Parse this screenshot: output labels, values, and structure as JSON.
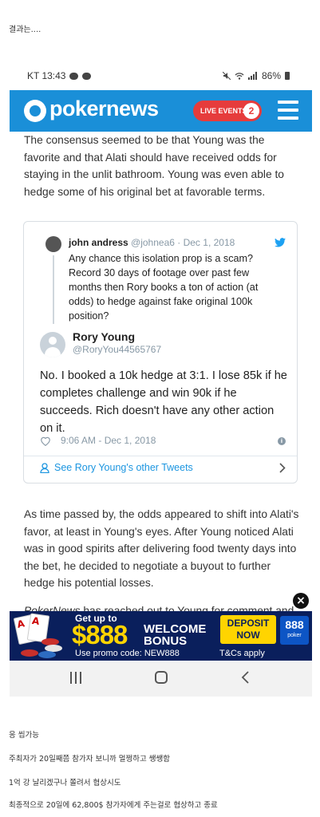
{
  "post": {
    "top_text": "결과는....",
    "comments": [
      "응 씹가능",
      "주최자가 20일째쯤 참가자 보니까 멀쩡하고 쌩쌩함",
      "1억 강 날리겠구나 쫄려서 협상시도",
      "최종적으로 20일에 62,800$ 참가자에게 주는걸로 협상하고 종료"
    ]
  },
  "status_bar": {
    "carrier_time": "KT 13:43",
    "battery": "86%"
  },
  "site_header": {
    "logo_text": "pokernews",
    "live_events_label": "LIVE EVENTS",
    "live_events_count": "2",
    "menu_icon": "hamburger-icon"
  },
  "article": {
    "para1": "The consensus seemed to be that Young was the favorite and that Alati should have received odds for staying in the unlit bathroom. Young was even able to hedge some of his original bet at favorable terms.",
    "para2": "As time passed by, the odds appeared to shift into Alati's favor, at least in Young's eyes. After Young noticed Alati was in good spirits after delivering food twenty days into the bet, he decided to negotiate a buyout to further hedge his potential losses.",
    "para3_italic": "PokerNews",
    "para3_rest": " has reached out to Young for comment and"
  },
  "tweet": {
    "quoted": {
      "name": "john andress",
      "handle": "@johnea6",
      "date": "· Dec 1, 2018",
      "text": "Any chance this isolation prop is a scam? Record 30 days of footage over past few months then Rory books a ton of action (at odds) to hedge against fake original 100k position?"
    },
    "author_name": "Rory Young",
    "author_handle": "@RoryYou44565767",
    "text": "No. I booked a 10k hedge at 3:1. I lose 85k if he completes challenge and win 90k if he succeeds. Rich doesn't have any other action on it.",
    "timestamp": "9:06 AM - Dec 1, 2018",
    "see_more": "See Rory Young's other Tweets"
  },
  "ad": {
    "get_up_to": "Get up to",
    "amount": "$888",
    "welcome": "WELCOME",
    "bonus": "BONUS",
    "promo": "Use promo code: NEW888",
    "deposit": "DEPOSIT",
    "now": "NOW",
    "tcs": "T&Cs apply",
    "logo": "888",
    "logo_sub": "poker",
    "close": "×"
  },
  "colors": {
    "pokernews_blue": "#1a8fd8",
    "live_red": "#e63c3c",
    "twitter_blue": "#1b95e0",
    "ad_navy": "#0a1f5c",
    "ad_yellow": "#ffd400"
  }
}
